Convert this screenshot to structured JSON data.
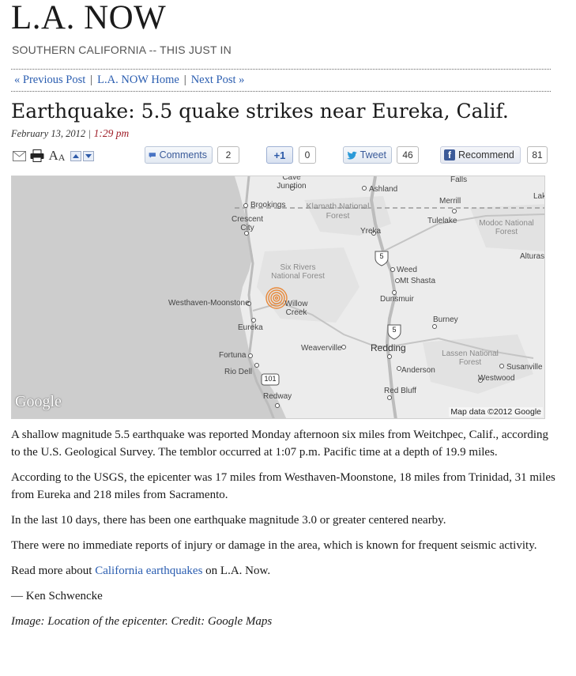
{
  "blog": {
    "title": "L.A. NOW",
    "subtitle": "SOUTHERN CALIFORNIA -- THIS JUST IN"
  },
  "nav": {
    "previous": "« Previous Post",
    "home": "L.A. NOW Home",
    "next": "Next Post »",
    "separator": "|"
  },
  "post": {
    "headline": "Earthquake: 5.5 quake strikes near Eureka, Calif.",
    "date": "February 13, 2012",
    "time": "1:29 pm",
    "date_separator": "|"
  },
  "toolbar": {
    "font_size_label": "AA",
    "comments_label": "Comments",
    "comments_count": "2",
    "plusone_label": "+1",
    "plusone_count": "0",
    "tweet_label": "Tweet",
    "tweet_count": "46",
    "recommend_label": "Recommend",
    "recommend_count": "81"
  },
  "map": {
    "logo": "Google",
    "credit": "Map data ©2012 Google",
    "places": {
      "cave_junction": "Cave Junction",
      "ashland": "Ashland",
      "falls": "Falls",
      "brookings": "Brookings",
      "klamath": "Klamath National Forest",
      "merrill": "Merrill",
      "lak": "Lak",
      "crescent_city": "Crescent City",
      "tulelake": "Tulelake",
      "modoc": "Modoc National Forest",
      "yreka": "Yreka",
      "alturas": "Alturas",
      "six_rivers": "Six Rivers National Forest",
      "weed": "Weed",
      "mt_shasta": "Mt Shasta",
      "westhaven": "Westhaven-Moonstone",
      "willow_creek": "Willow Creek",
      "dunsmuir": "Dunsmuir",
      "burney": "Burney",
      "eureka": "Eureka",
      "weaverville": "Weaverville",
      "redding": "Redding",
      "lassen": "Lassen National Forest",
      "fortuna": "Fortuna",
      "rio_dell": "Rio Dell",
      "anderson": "Anderson",
      "susanville": "Susanville",
      "westwood": "Westwood",
      "red_bluff": "Red Bluff",
      "redway": "Redway"
    },
    "shields": {
      "i5_north": "5",
      "i5_south": "5",
      "us101": "101"
    }
  },
  "article": {
    "p1": "A shallow magnitude 5.5 earthquake was reported Monday afternoon six miles from Weitchpec, Calif., according to the U.S. Geological Survey. The temblor occurred at 1:07 p.m. Pacific time at a depth of 19.9 miles.",
    "p2": "According to the USGS, the epicenter was 17 miles from Westhaven-Moonstone, 18 miles from Trinidad, 31 miles from Eureka and 218 miles from Sacramento.",
    "p3": "In the last 10 days, there has been one earthquake magnitude 3.0 or greater centered nearby.",
    "p4": "There were no immediate reports of injury or damage in the area, which is known for frequent seismic activity.",
    "p5_before": "Read more about ",
    "p5_link": "California earthquakes",
    "p5_after": " on L.A. Now.",
    "byline": "— Ken Schwencke",
    "caption": "Image: Location of the epicenter. Credit: Google Maps"
  },
  "colors": {
    "link": "#2a5db0",
    "time": "#a0202a",
    "epicenter": "#e8893a"
  }
}
